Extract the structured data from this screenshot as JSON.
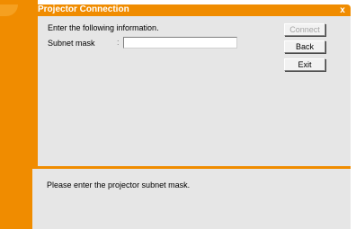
{
  "window": {
    "title": "Projector Connection",
    "close_glyph": "x",
    "accent_color": "#f08c00",
    "panel_color": "#e6e6e6"
  },
  "form": {
    "instruction": "Enter the following information.",
    "subnet_label": "Subnet mask",
    "colon": ":",
    "subnet_value": ""
  },
  "buttons": {
    "connect": "Connect",
    "back": "Back",
    "exit": "Exit"
  },
  "status": {
    "message": "Please enter the projector subnet mask."
  }
}
